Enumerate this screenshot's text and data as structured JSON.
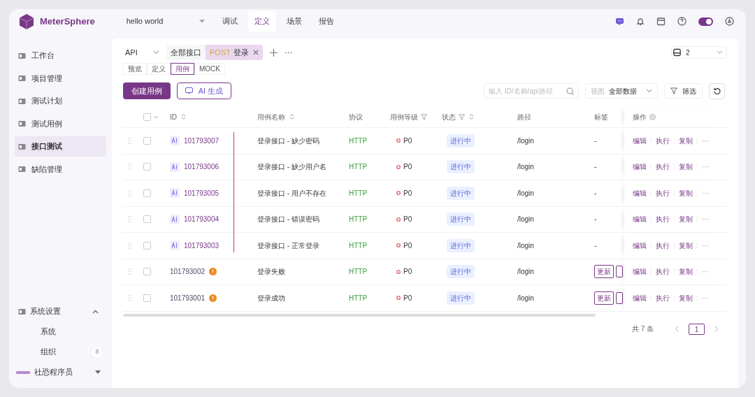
{
  "brand": "MeterSphere",
  "project": "hello world",
  "top_tabs": [
    {
      "label": "调试",
      "selected": false
    },
    {
      "label": "定义",
      "selected": true
    },
    {
      "label": "场景",
      "selected": false
    },
    {
      "label": "报告",
      "selected": false
    }
  ],
  "theme_toggle": {
    "on": true
  },
  "sidebar": {
    "items": [
      {
        "label": "工作台",
        "selected": false
      },
      {
        "label": "项目管理",
        "selected": false
      },
      {
        "label": "测试计划",
        "selected": false
      },
      {
        "label": "测试用例",
        "selected": false
      },
      {
        "label": "接口测试",
        "selected": true
      },
      {
        "label": "缺陷管理",
        "selected": false
      }
    ],
    "settings": {
      "label": "系统设置",
      "expanded": true,
      "children": [
        {
          "label": "系统"
        },
        {
          "label": "组织",
          "badge": "8"
        }
      ]
    },
    "user": "社恐程序员"
  },
  "module_select": "API",
  "doc_tabs": [
    {
      "label": "全部接口",
      "selected": false
    },
    {
      "label": "登录",
      "method": "POST",
      "selected": true
    }
  ],
  "version": "2",
  "sub_tabs": [
    {
      "label": "预览",
      "selected": false
    },
    {
      "label": "定义",
      "selected": false
    },
    {
      "label": "用例",
      "selected": true
    },
    {
      "label": "MOCK",
      "selected": false
    }
  ],
  "buttons": {
    "create": "创建用例",
    "ai": "AI 生成",
    "filter": "筛选"
  },
  "search": {
    "placeholder": "输入 ID/名称/api路径"
  },
  "view": {
    "label": "视图",
    "value": "全部数据"
  },
  "table": {
    "columns": [
      "ID",
      "用例名称",
      "协议",
      "用例等级",
      "状态",
      "路径",
      "标签",
      "操作"
    ],
    "select_all_checked": false,
    "rows": [
      {
        "checked": false,
        "ai": true,
        "id": "101793007",
        "warning": false,
        "name": "登录接口 - 缺少密码",
        "protocol": "HTTP",
        "level": "P0",
        "status": "进行中",
        "path": "/login",
        "tags": [
          "-"
        ],
        "tag_overflow": false,
        "actions": [
          "编辑",
          "执行",
          "复制",
          "···"
        ]
      },
      {
        "checked": false,
        "ai": true,
        "id": "101793006",
        "warning": false,
        "name": "登录接口 - 缺少用户名",
        "protocol": "HTTP",
        "level": "P0",
        "status": "进行中",
        "path": "/login",
        "tags": [
          "-"
        ],
        "tag_overflow": false,
        "actions": [
          "编辑",
          "执行",
          "复制",
          "···"
        ]
      },
      {
        "checked": false,
        "ai": true,
        "id": "101793005",
        "warning": false,
        "name": "登录接口 - 用户不存在",
        "protocol": "HTTP",
        "level": "P0",
        "status": "进行中",
        "path": "/login",
        "tags": [
          "-"
        ],
        "tag_overflow": false,
        "actions": [
          "编辑",
          "执行",
          "复制",
          "···"
        ]
      },
      {
        "checked": false,
        "ai": true,
        "id": "101793004",
        "warning": false,
        "name": "登录接口 - 错误密码",
        "protocol": "HTTP",
        "level": "P0",
        "status": "进行中",
        "path": "/login",
        "tags": [
          "-"
        ],
        "tag_overflow": false,
        "actions": [
          "编辑",
          "执行",
          "复制",
          "···"
        ]
      },
      {
        "checked": false,
        "ai": true,
        "id": "101793003",
        "warning": false,
        "name": "登录接口 - 正常登录",
        "protocol": "HTTP",
        "level": "P0",
        "status": "进行中",
        "path": "/login",
        "tags": [
          "-"
        ],
        "tag_overflow": false,
        "actions": [
          "编辑",
          "执行",
          "复制",
          "···"
        ]
      },
      {
        "checked": false,
        "ai": false,
        "id": "101793002",
        "warning": true,
        "name": "登录失败",
        "protocol": "HTTP",
        "level": "P0",
        "status": "进行中",
        "path": "/login",
        "tags": [
          "更新"
        ],
        "tag_overflow": true,
        "actions": [
          "编辑",
          "执行",
          "复制",
          "···"
        ]
      },
      {
        "checked": false,
        "ai": false,
        "id": "101793001",
        "warning": true,
        "name": "登录成功",
        "protocol": "HTTP",
        "level": "P0",
        "status": "进行中",
        "path": "/login",
        "tags": [
          "更新"
        ],
        "tag_overflow": true,
        "actions": [
          "编辑",
          "执行",
          "复制",
          "···"
        ]
      }
    ]
  },
  "pagination": {
    "total": "共 7 条",
    "page": "1"
  }
}
